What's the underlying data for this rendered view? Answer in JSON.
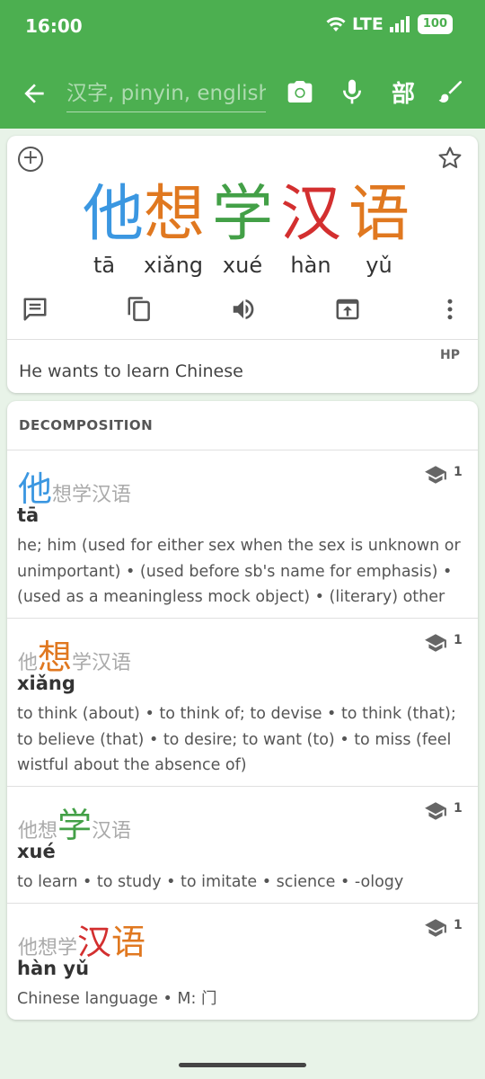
{
  "status": {
    "time": "16:00",
    "network": "LTE",
    "battery": "100"
  },
  "toolbar": {
    "search_placeholder": "汉字, pinyin, english",
    "radical_label": "部"
  },
  "headword": {
    "characters": [
      {
        "char": "他",
        "color": "#3b97e1"
      },
      {
        "char": "想",
        "color": "#e07820"
      },
      {
        "char": "学",
        "color": "#43a047"
      },
      {
        "char": "汉",
        "color": "#d32f2f"
      },
      {
        "char": "语",
        "color": "#e07820"
      }
    ],
    "pinyin": [
      "tā",
      "xiǎng",
      "xué",
      "hàn",
      "yǔ"
    ],
    "source": "HP",
    "translation": "He wants to learn Chinese"
  },
  "decomposition": {
    "title": "DECOMPOSITION",
    "entries": [
      {
        "before": "",
        "highlight": "他",
        "after": "想学汉语",
        "highlight_color": "#3b97e1",
        "reading": "tā",
        "definition": "he; him (used for either sex when the sex is unknown or unimportant) • (used before sb's name for emphasis) • (used as a meaningless mock object) • (literary) other",
        "count": "1"
      },
      {
        "before": "他",
        "highlight": "想",
        "after": "学汉语",
        "highlight_color": "#e07820",
        "reading": "xiǎng",
        "definition": "to think (about) • to think of; to devise • to think (that); to believe (that) • to desire; to want (to) • to miss (feel wistful about the absence of)",
        "count": "1"
      },
      {
        "before": "他想",
        "highlight": "学",
        "after": "汉语",
        "highlight_color": "#43a047",
        "reading": "xué",
        "definition": "to learn • to study • to imitate • science • -ology",
        "count": "1"
      },
      {
        "before": "他想学",
        "highlight": "汉",
        "highlight2": "语",
        "after": "",
        "highlight_color": "#d32f2f",
        "highlight2_color": "#e07820",
        "reading": "hàn yǔ",
        "definition": "Chinese language • M: 门",
        "count": "1"
      }
    ]
  }
}
